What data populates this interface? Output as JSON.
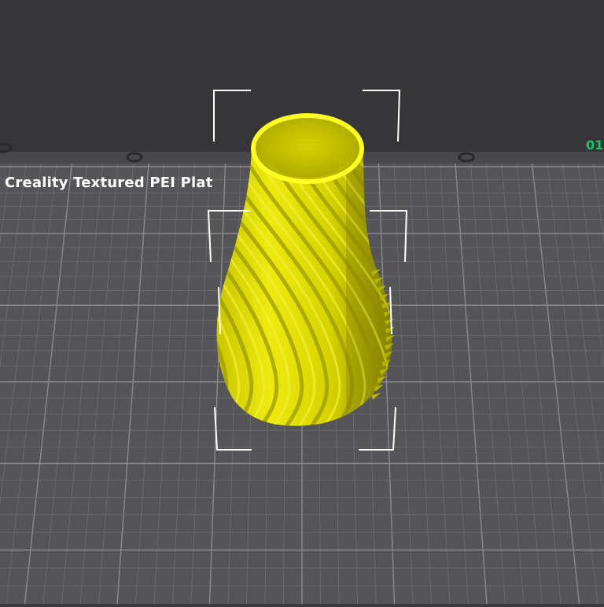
{
  "plate": {
    "name": "Creality Textured PEI Plat",
    "number": "01"
  },
  "model": {
    "type": "twisted-vase",
    "color": "#e3e000",
    "rim_color": "#ffff22",
    "selected": true
  },
  "colors": {
    "background": "#3a3a3c",
    "plate_surface": "#555558",
    "grid_minor": "#6e6e72",
    "grid_major": "#8a8a8e",
    "selection_bracket": "#ffffff",
    "plate_number": "#22c06a"
  }
}
